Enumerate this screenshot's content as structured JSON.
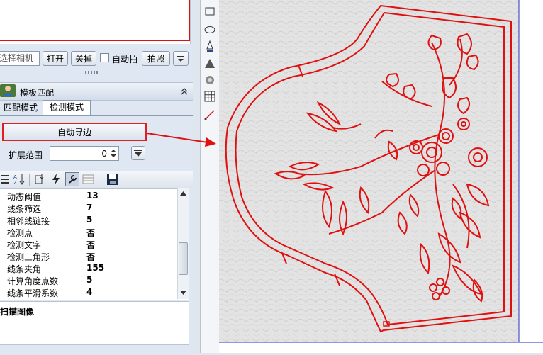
{
  "toolbar": {
    "camera_combo": "选择相机",
    "open_label": "打开",
    "close_label": "关掉",
    "auto_shoot_label": "自动拍",
    "shoot_label": "拍照"
  },
  "panel": {
    "title": "模板匹配",
    "tabs": [
      "匹配模式",
      "检测模式"
    ],
    "active_tab": "检测模式",
    "auto_edge_label": "自动寻边",
    "range_label": "扩展范围",
    "range_value": "0"
  },
  "properties": [
    {
      "name": "动态阈值",
      "value": "13"
    },
    {
      "name": "线条筛选",
      "value": "7"
    },
    {
      "name": "相邻线链接",
      "value": "5"
    },
    {
      "name": "检测点",
      "value": "否"
    },
    {
      "name": "检测文字",
      "value": "否"
    },
    {
      "name": "检测三角形",
      "value": "否"
    },
    {
      "name": "线条夹角",
      "value": "155"
    },
    {
      "name": "计算角度点数",
      "value": "5"
    },
    {
      "name": "线条平滑系数",
      "value": "4"
    }
  ],
  "description": {
    "title": "扫描图像"
  },
  "colors": {
    "accent_red": "#e01010",
    "panel_bg": "#dfe8f2",
    "canvas_border": "#2030c0"
  }
}
